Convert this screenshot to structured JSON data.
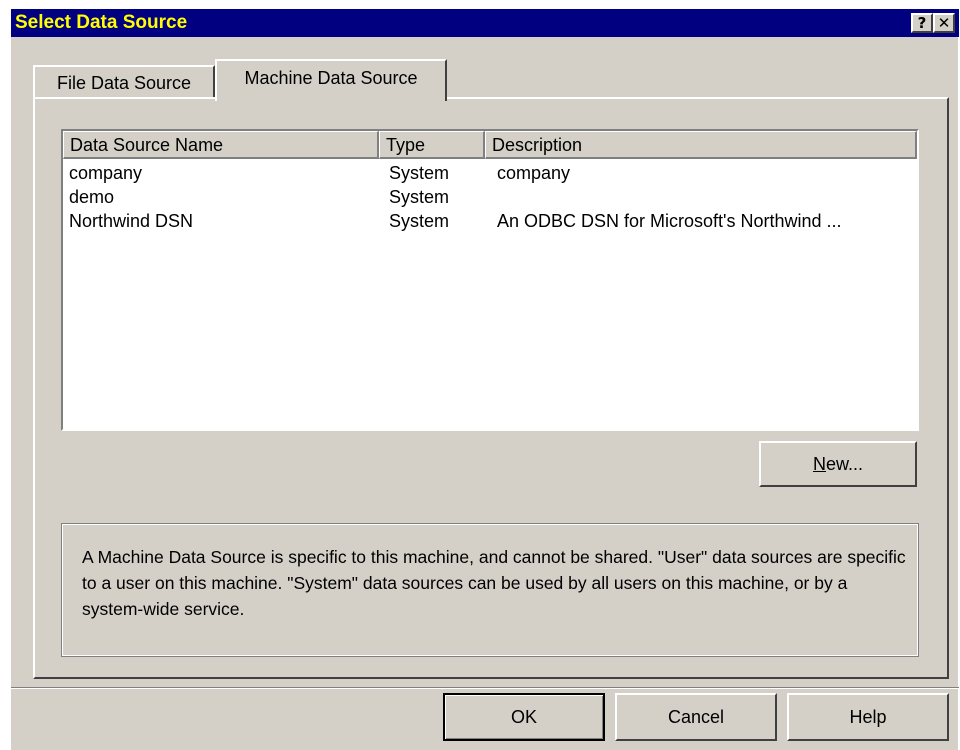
{
  "window": {
    "title": "Select Data Source",
    "help_glyph": "?",
    "close_glyph": "✕"
  },
  "tabs": [
    {
      "label": "File Data Source",
      "active": false
    },
    {
      "label": "Machine Data Source",
      "active": true
    }
  ],
  "list": {
    "columns": [
      "Data Source Name",
      "Type",
      "Description"
    ],
    "rows": [
      {
        "name": "company",
        "type": "System",
        "description": "company"
      },
      {
        "name": "demo",
        "type": "System",
        "description": ""
      },
      {
        "name": "Northwind DSN",
        "type": "System",
        "description": "An ODBC DSN for Microsoft's Northwind ..."
      }
    ]
  },
  "new_button": {
    "label_pre": "",
    "mnemonic": "N",
    "label_post": "ew..."
  },
  "info_text": "A Machine Data Source is specific to this machine, and cannot be shared.  \"User\" data sources are specific to a user on this machine.  \"System\" data sources can be used by all users on this machine, or by a system-wide service.",
  "footer_buttons": {
    "ok": "OK",
    "cancel": "Cancel",
    "help": "Help"
  },
  "colors": {
    "title_bar": "#000080",
    "title_text": "#ffff00",
    "face": "#d4d0c8"
  }
}
